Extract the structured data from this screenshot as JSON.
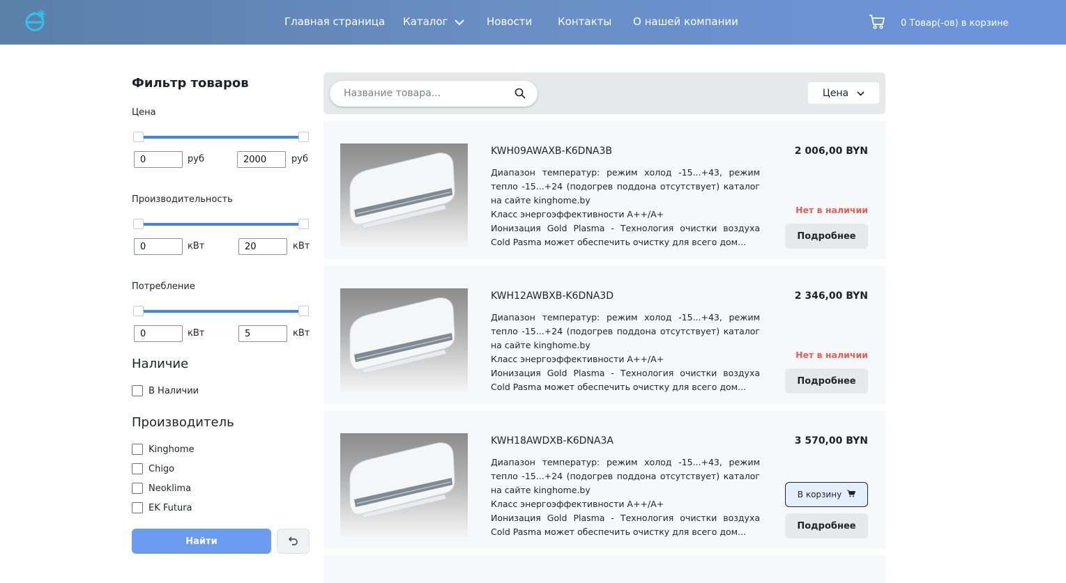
{
  "header": {
    "nav": [
      {
        "label": "Главная страница"
      },
      {
        "label": "Каталог"
      },
      {
        "label": "Новости"
      },
      {
        "label": "Контакты"
      },
      {
        "label": "О нашей компании"
      }
    ],
    "cart_label": "0 Товар(-ов) в корзине"
  },
  "filters": {
    "title": "Фильтр товаров",
    "price": {
      "title": "Цена",
      "min": "0",
      "max": "2000",
      "unit": "руб"
    },
    "power": {
      "title": "Производительность",
      "min": "0",
      "max": "20",
      "unit": "кВт"
    },
    "consumption": {
      "title": "Потребление",
      "min": "0",
      "max": "5",
      "unit": "кВт"
    },
    "availability": {
      "title": "Наличие",
      "options": [
        "В Наличии"
      ]
    },
    "manufacturer": {
      "title": "Производитель",
      "options": [
        "Kinghome",
        "Chigo",
        "Neoklima",
        "EK Futura"
      ]
    },
    "find_label": "Найти"
  },
  "search": {
    "placeholder": "Название товара...",
    "sort_label": "Цена"
  },
  "products": [
    {
      "name": "KWH09AWAXB-K6DNA3B",
      "price": "2 006,00 BYN",
      "desc": "Диапазон температур: режим холод -15...+43, режим тепло -15...+24 (подогрев поддона отсутствует) каталог на сайте kinghome.by",
      "desc2": "Класс энергоэффективности A++/A+",
      "desc3": "Ионизация Gold Plasma - Технология очистки воздуха Cold Pasma может обеспечить очистку для всего дом...",
      "stock": "Нет в наличии",
      "more_label": "Подробнее"
    },
    {
      "name": "KWH12AWBXB-K6DNA3D",
      "price": "2 346,00 BYN",
      "desc": "Диапазон температур: режим холод -15...+43, режим тепло -15...+24 (подогрев поддона отсутствует) каталог на сайте kinghome.by",
      "desc2": "Класс энергоэффективности A++/A+",
      "desc3": "Ионизация Gold Plasma - Технология очистки воздуха Cold Pasma может обеспечить очистку для всего дом...",
      "stock": "Нет в наличии",
      "more_label": "Подробнее"
    },
    {
      "name": "KWH18AWDXB-K6DNA3A",
      "price": "3 570,00 BYN",
      "desc": "Диапазон температур: режим холод -15...+43, режим тепло -15...+24 (подогрев поддона отсутствует) каталог на сайте kinghome.by",
      "desc2": "Класс энергоэффективности A++/A+",
      "desc3": "Ионизация Gold Plasma - Технология очистки воздуха Cold Pasma может обеспечить очистку для всего дом...",
      "cart_label": "В корзину",
      "more_label": "Подробнее"
    }
  ],
  "colors": {
    "accent": "#3b82f6",
    "out_of_stock": "#ee5b5b",
    "header_start": "#5a7fa8",
    "header_end": "#6c95dc"
  }
}
